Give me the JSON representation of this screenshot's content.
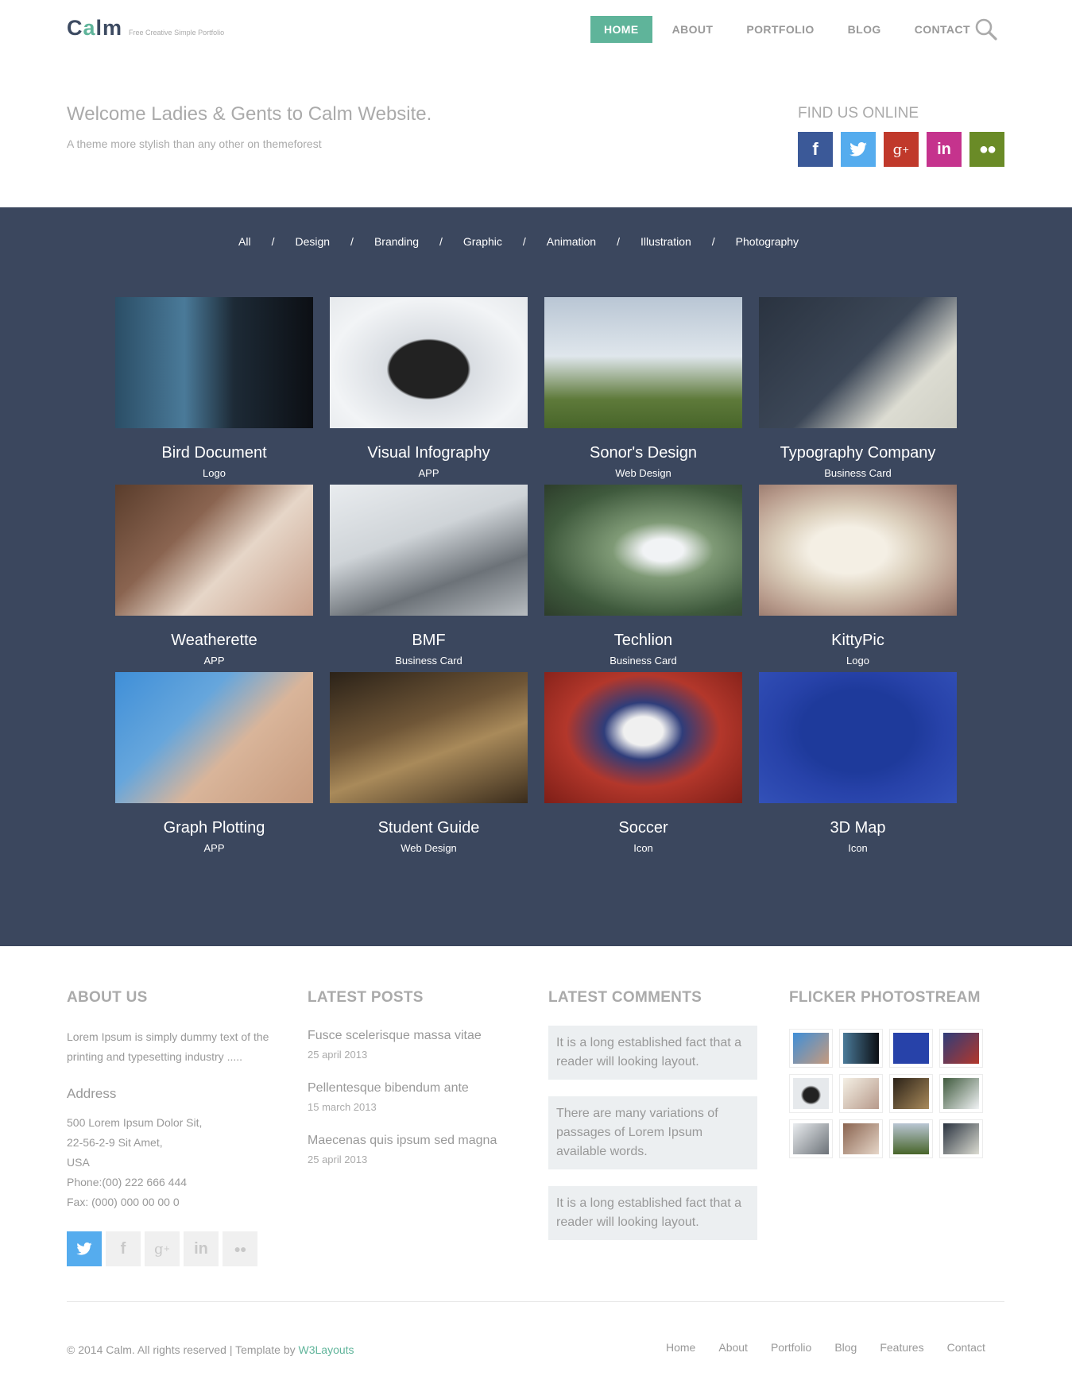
{
  "header": {
    "logo_text": "Calm",
    "tagline": "Free Creative Simple Portfolio",
    "nav": [
      "HOME",
      "ABOUT",
      "PORTFOLIO",
      "BLOG",
      "CONTACT"
    ],
    "active_nav": "HOME"
  },
  "welcome": {
    "title": "Welcome Ladies & Gents to Calm Website.",
    "subtitle": "A theme more stylish than any other on themeforest"
  },
  "find_us": {
    "title": "FIND US ONLINE",
    "networks": [
      {
        "icon": "facebook-icon",
        "glyph": "f",
        "color": "#3b5998"
      },
      {
        "icon": "twitter-icon",
        "glyph": "",
        "color": "#55acee"
      },
      {
        "icon": "google-plus-icon",
        "glyph": "g+",
        "color": "#c0392b"
      },
      {
        "icon": "linkedin-icon",
        "glyph": "in",
        "color": "#c5338d"
      },
      {
        "icon": "flickr-icon",
        "glyph": "••",
        "color": "#6a8b27"
      }
    ]
  },
  "portfolio": {
    "filters": [
      "All",
      "Design",
      "Branding",
      "Graphic",
      "Animation",
      "Illustration",
      "Photography"
    ],
    "separator": "/",
    "items": [
      {
        "title": "Bird Document",
        "category": "Logo"
      },
      {
        "title": "Visual Infography",
        "category": "APP"
      },
      {
        "title": "Sonor's Design",
        "category": "Web Design"
      },
      {
        "title": "Typography Company",
        "category": "Business Card"
      },
      {
        "title": "Weatherette",
        "category": "APP"
      },
      {
        "title": "BMF",
        "category": "Business Card"
      },
      {
        "title": "Techlion",
        "category": "Business Card"
      },
      {
        "title": "KittyPic",
        "category": "Logo"
      },
      {
        "title": "Graph Plotting",
        "category": "APP"
      },
      {
        "title": "Student Guide",
        "category": "Web Design"
      },
      {
        "title": "Soccer",
        "category": "Icon"
      },
      {
        "title": "3D Map",
        "category": "Icon"
      }
    ]
  },
  "footer": {
    "about": {
      "title": "ABOUT US",
      "text": "Lorem Ipsum is simply dummy text of the printing and typesetting industry .....",
      "address_label": "Address",
      "address_lines": [
        "500 Lorem Ipsum Dolor Sit,",
        "22-56-2-9 Sit Amet,",
        "USA",
        "Phone:(00) 222 666 444",
        "Fax: (000) 000 00 00 0"
      ]
    },
    "posts": {
      "title": "LATEST POSTS",
      "items": [
        {
          "title": "Fusce scelerisque massa vitae",
          "date": "25 april 2013"
        },
        {
          "title": "Pellentesque bibendum ante",
          "date": "15 march 2013"
        },
        {
          "title": "Maecenas quis ipsum sed magna",
          "date": "25 april 2013"
        }
      ]
    },
    "comments": {
      "title": "LATEST COMMENTS",
      "items": [
        "It is a long established fact that a reader will looking layout.",
        "There are many variations of passages of Lorem Ipsum available words.",
        "It is a long established fact that a reader will looking layout."
      ]
    },
    "flickr": {
      "title": "FLICKER PHOTOSTREAM"
    },
    "copyright": "© 2014 Calm. All rights reserved | Template by",
    "credit_link": "W3Layouts",
    "nav": [
      "Home",
      "About",
      "Portfolio",
      "Blog",
      "Features",
      "Contact"
    ]
  },
  "colors": {
    "accent": "#5fb49a",
    "dark_band": "#3b475e"
  }
}
